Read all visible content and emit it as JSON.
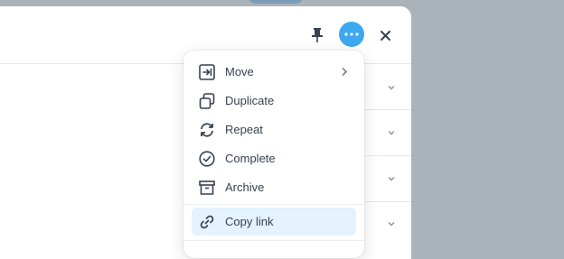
{
  "menu": {
    "items": [
      {
        "label": "Move",
        "icon": "move-icon"
      },
      {
        "label": "Duplicate",
        "icon": "duplicate-icon"
      },
      {
        "label": "Repeat",
        "icon": "repeat-icon"
      },
      {
        "label": "Complete",
        "icon": "complete-icon"
      },
      {
        "label": "Archive",
        "icon": "archive-icon"
      },
      {
        "label": "Copy link",
        "icon": "link-icon"
      }
    ],
    "highlighted": "Copy link"
  },
  "toolbar": {
    "pin_icon": "pin-icon",
    "more_icon": "more-horizontal-icon",
    "close_icon": "close-icon"
  },
  "colors": {
    "accent": "#3da8f0",
    "highlight": "#e4f3fd",
    "overlay": "#aab2ba"
  }
}
